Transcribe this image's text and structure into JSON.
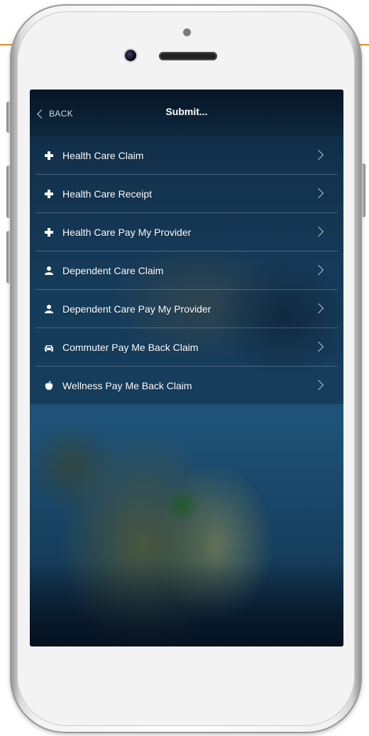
{
  "nav": {
    "back_label": "BACK",
    "title": "Submit..."
  },
  "menu": {
    "items": [
      {
        "label": "Health Care Claim",
        "icon": "plus-icon"
      },
      {
        "label": "Health Care Receipt",
        "icon": "plus-icon"
      },
      {
        "label": "Health Care Pay My Provider",
        "icon": "plus-icon"
      },
      {
        "label": "Dependent Care Claim",
        "icon": "person-icon"
      },
      {
        "label": "Dependent Care Pay My Provider",
        "icon": "person-icon"
      },
      {
        "label": "Commuter Pay Me Back Claim",
        "icon": "car-icon"
      },
      {
        "label": "Wellness Pay Me Back Claim",
        "icon": "apple-icon"
      }
    ]
  },
  "colors": {
    "accent": "#e58a2a",
    "nav_background": "#0b2238",
    "menu_text": "#ffffff"
  }
}
